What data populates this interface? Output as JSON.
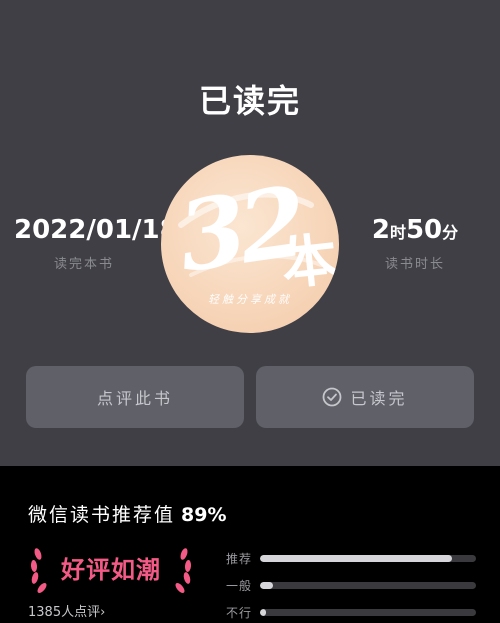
{
  "header": {
    "title": "已读完"
  },
  "stats": {
    "finish_date": "2022/01/18",
    "finish_date_label": "读完本书",
    "read_hours": "2",
    "hours_unit": "时",
    "read_minutes": "50",
    "minutes_unit": "分",
    "read_time_label": "读书时长"
  },
  "badge": {
    "count": "32",
    "unit": "本",
    "stamp": "轻触分享成就",
    "colors": {
      "circle": "#f6d2b4",
      "stroke": "#ffffff"
    }
  },
  "buttons": {
    "review_label": "点评此书",
    "done_label": "已读完"
  },
  "rating": {
    "label": "微信读书推荐值",
    "percent": "89%",
    "tag": "好评如潮",
    "tag_color": "#f35b86",
    "reviewer_count": "1385",
    "reviewer_suffix": "人点评",
    "bars": [
      {
        "label": "推荐",
        "fraction": 0.89
      },
      {
        "label": "一般",
        "fraction": 0.06
      },
      {
        "label": "不行",
        "fraction": 0.03
      }
    ]
  }
}
